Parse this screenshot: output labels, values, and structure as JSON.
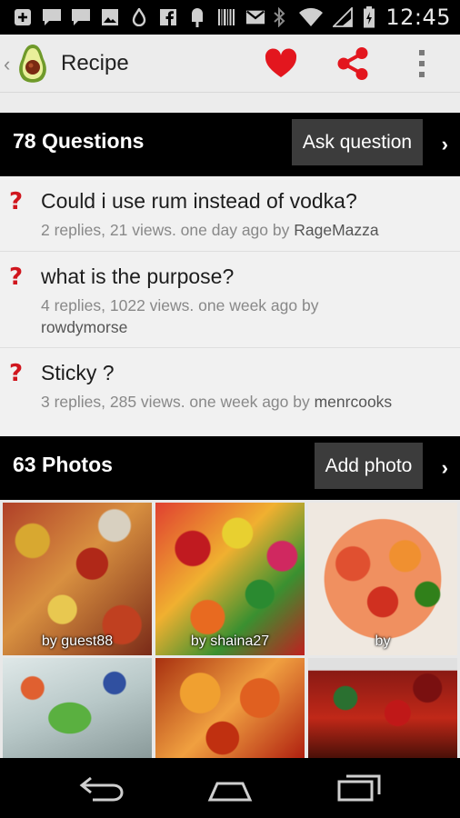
{
  "status_bar": {
    "time": "12:45",
    "notification_icons": [
      "add-box-icon",
      "chat-bubble-icon",
      "chat-bubble-icon",
      "image-icon",
      "drop-icon",
      "facebook-icon",
      "popsicle-icon",
      "barcode-icon",
      "gmail-icon"
    ],
    "system_icons": [
      "bluetooth-icon",
      "wifi-icon",
      "signal-icon",
      "battery-charging-icon"
    ]
  },
  "action_bar": {
    "title": "Recipe",
    "actions": [
      "heart-icon",
      "share-icon",
      "overflow-menu-icon"
    ],
    "colors": {
      "accent_red": "#e3161e"
    }
  },
  "questions": {
    "header_title": "78 Questions",
    "button_label": "Ask question",
    "items": [
      {
        "title": "Could i use rum instead of vodka?",
        "meta": "2 replies, 21 views. one day ago by ",
        "user": "RageMazza"
      },
      {
        "title": "what is the purpose?",
        "meta": "4 replies, 1022 views. one week ago by ",
        "user": "rowdymorse"
      },
      {
        "title": "Sticky ?",
        "meta": "3 replies, 285 views. one week ago by ",
        "user": "menrcooks"
      }
    ]
  },
  "photos": {
    "header_title": "63 Photos",
    "button_label": "Add photo",
    "items": [
      {
        "caption": "by guest88"
      },
      {
        "caption": "by shaina27"
      },
      {
        "caption": "by"
      },
      {
        "caption": ""
      },
      {
        "caption": ""
      },
      {
        "caption": ""
      }
    ]
  },
  "nav_bar": {
    "buttons": [
      "back-icon",
      "home-icon",
      "recents-icon"
    ]
  }
}
